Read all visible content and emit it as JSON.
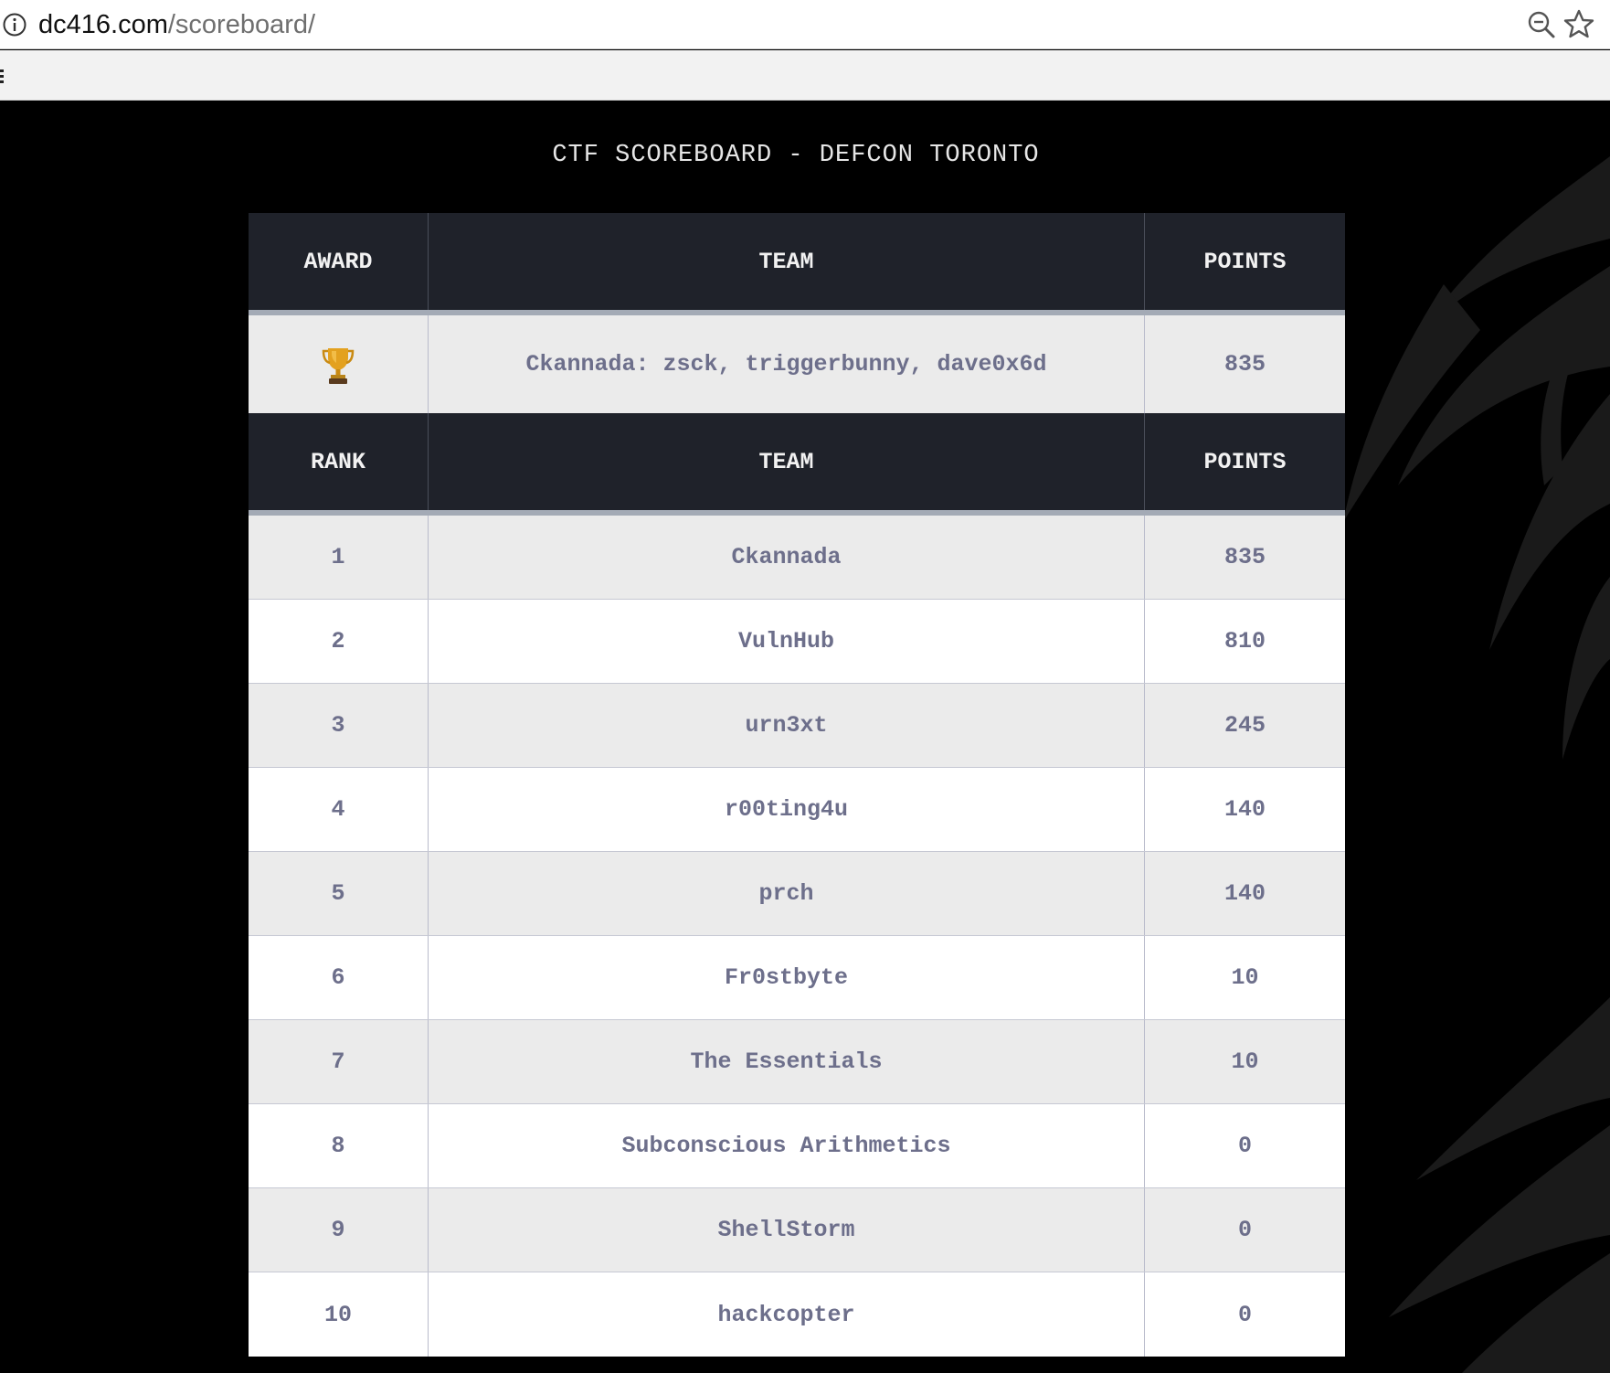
{
  "browser": {
    "url_host": "dc416.com",
    "url_path": "/scoreboard/",
    "icons": [
      "info-icon",
      "zoom-out-icon",
      "bookmark-star-icon"
    ]
  },
  "page": {
    "title": "CTF SCOREBOARD - DEFCON TORONTO"
  },
  "award_table": {
    "headers": [
      "AWARD",
      "TEAM",
      "POINTS"
    ],
    "row": {
      "award_icon": "trophy-icon",
      "team": "Ckannada: zsck, triggerbunny, dave0x6d",
      "points": "835"
    }
  },
  "rank_table": {
    "headers": [
      "RANK",
      "TEAM",
      "POINTS"
    ],
    "rows": [
      {
        "rank": "1",
        "team": "Ckannada",
        "points": "835"
      },
      {
        "rank": "2",
        "team": "VulnHub",
        "points": "810"
      },
      {
        "rank": "3",
        "team": "urn3xt",
        "points": "245"
      },
      {
        "rank": "4",
        "team": "r00ting4u",
        "points": "140"
      },
      {
        "rank": "5",
        "team": "prch",
        "points": "140"
      },
      {
        "rank": "6",
        "team": "Fr0stbyte",
        "points": "10"
      },
      {
        "rank": "7",
        "team": "The Essentials",
        "points": "10"
      },
      {
        "rank": "8",
        "team": "Subconscious Arithmetics",
        "points": "0"
      },
      {
        "rank": "9",
        "team": "ShellStorm",
        "points": "0"
      },
      {
        "rank": "10",
        "team": "hackcopter",
        "points": "0"
      }
    ]
  },
  "colors": {
    "page_bg": "#000000",
    "header_bg": "#1f222a",
    "header_divider": "#a3aab5",
    "row_alt": "#ebebeb",
    "row_text": "#6d6f8b"
  }
}
